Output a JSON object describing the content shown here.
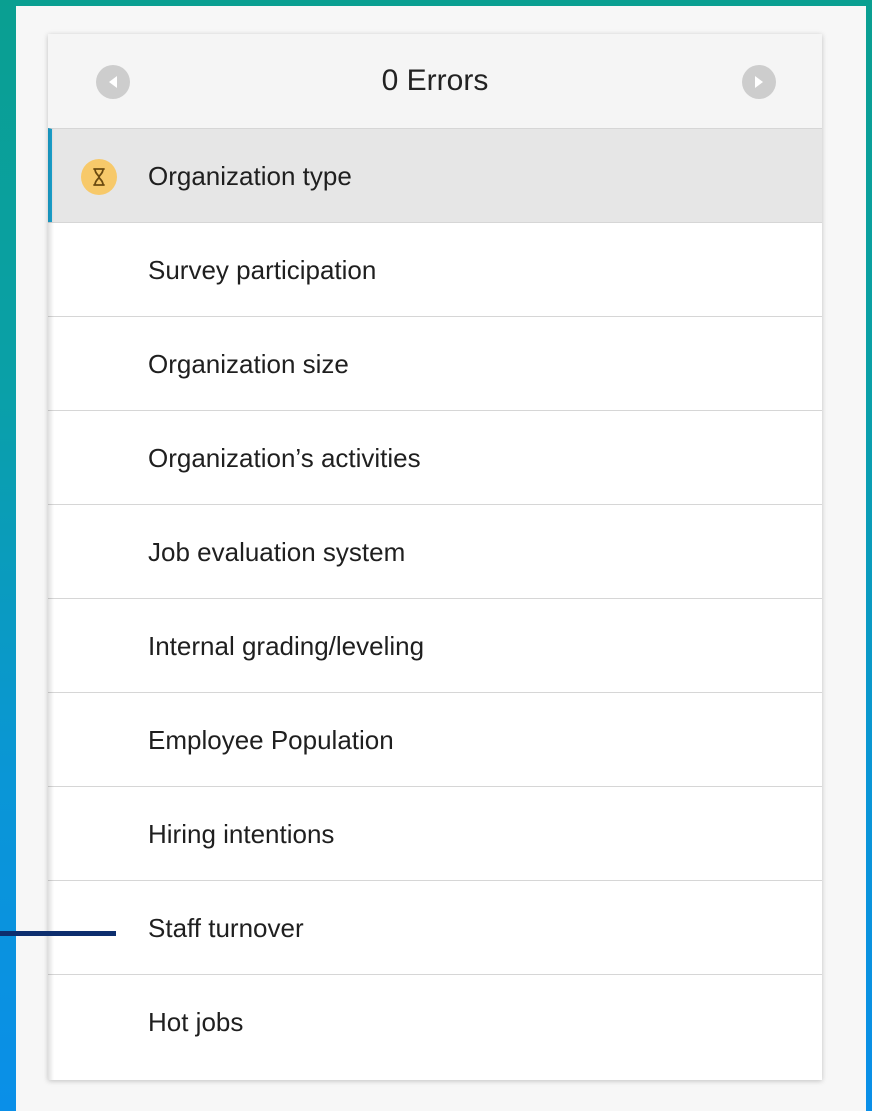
{
  "header": {
    "title": "0 Errors",
    "prev_icon": "chevron-left-circle-icon",
    "next_icon": "chevron-right-circle-icon"
  },
  "sections": [
    {
      "label": "Organization type",
      "active": true,
      "status_icon": "hourglass-icon"
    },
    {
      "label": "Survey participation"
    },
    {
      "label": "Organization size"
    },
    {
      "label": "Organization’s activities"
    },
    {
      "label": "Job evaluation system"
    },
    {
      "label": "Internal grading/leveling"
    },
    {
      "label": "Employee Population"
    },
    {
      "label": "Hiring intentions"
    },
    {
      "label": "Staff turnover"
    },
    {
      "label": "Hot jobs"
    }
  ],
  "colors": {
    "frame_gradient_top": "#0a9f91",
    "frame_gradient_bottom": "#0a8fe8",
    "active_accent": "#1aa3d0",
    "active_background": "#e6e6e6",
    "status_icon_background": "#f7c96a",
    "pointer_line": "#0d2e6e"
  }
}
